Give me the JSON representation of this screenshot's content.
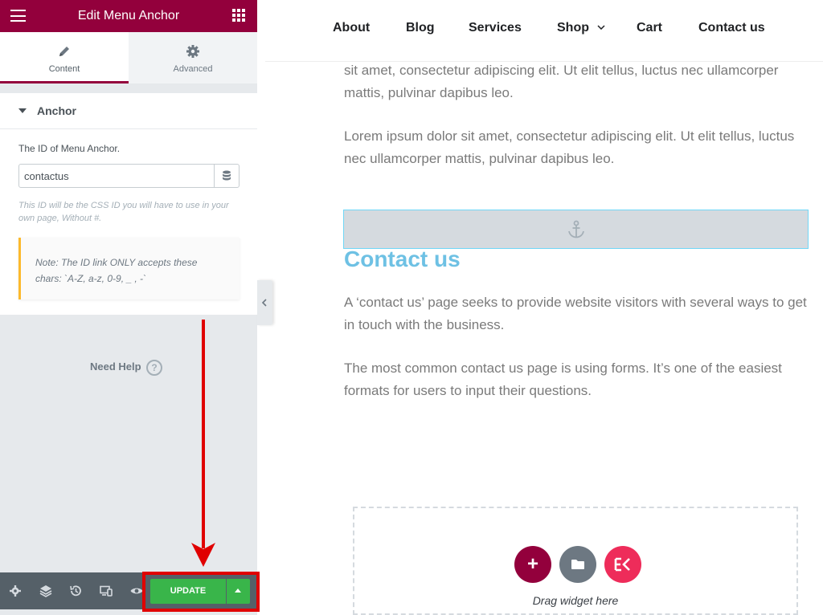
{
  "panel": {
    "title": "Edit Menu Anchor",
    "tabs": [
      {
        "label": "Content"
      },
      {
        "label": "Advanced"
      }
    ],
    "section": {
      "title": "Anchor",
      "field_label": "The ID of Menu Anchor.",
      "input_value": "contactus",
      "help_text": "This ID will be the CSS ID you will have to use in your own page, Without #.",
      "note": "Note: The ID link ONLY accepts these chars: `A-Z, a-z, 0-9, _ , -`"
    },
    "need_help": "Need Help",
    "footer": {
      "update_label": "UPDATE"
    }
  },
  "nav": {
    "items": [
      "About",
      "Blog",
      "Services",
      "Shop",
      "Cart",
      "Contact us"
    ]
  },
  "content": {
    "para1": "sit amet, consectetur adipiscing elit. Ut elit tellus, luctus nec ullamcorper mattis, pulvinar dapibus leo.",
    "para2": "Lorem ipsum dolor sit amet, consectetur adipiscing elit. Ut elit tellus, luctus nec ullamcorper mattis, pulvinar dapibus leo.",
    "heading": "Contact us",
    "para3": "A ‘contact us’ page seeks to provide website visitors with several ways to get in touch with the business.",
    "para4": "The most common contact us page is using forms. It’s one of the easiest formats for users to input their questions.",
    "drag_text": "Drag widget here"
  },
  "colors": {
    "brand": "#93003c",
    "update_green": "#39b54a",
    "heading_blue": "#6ec1e4",
    "annotation_red": "#e00000",
    "note_border": "#fcb92c"
  },
  "icons": {
    "menu": "hamburger-icon",
    "apps": "grid-icon",
    "content_tab": "pencil-icon",
    "advanced_tab": "gear-icon",
    "dynamic": "database-icon",
    "help": "question-circle-icon",
    "anchor": "anchor-icon"
  }
}
